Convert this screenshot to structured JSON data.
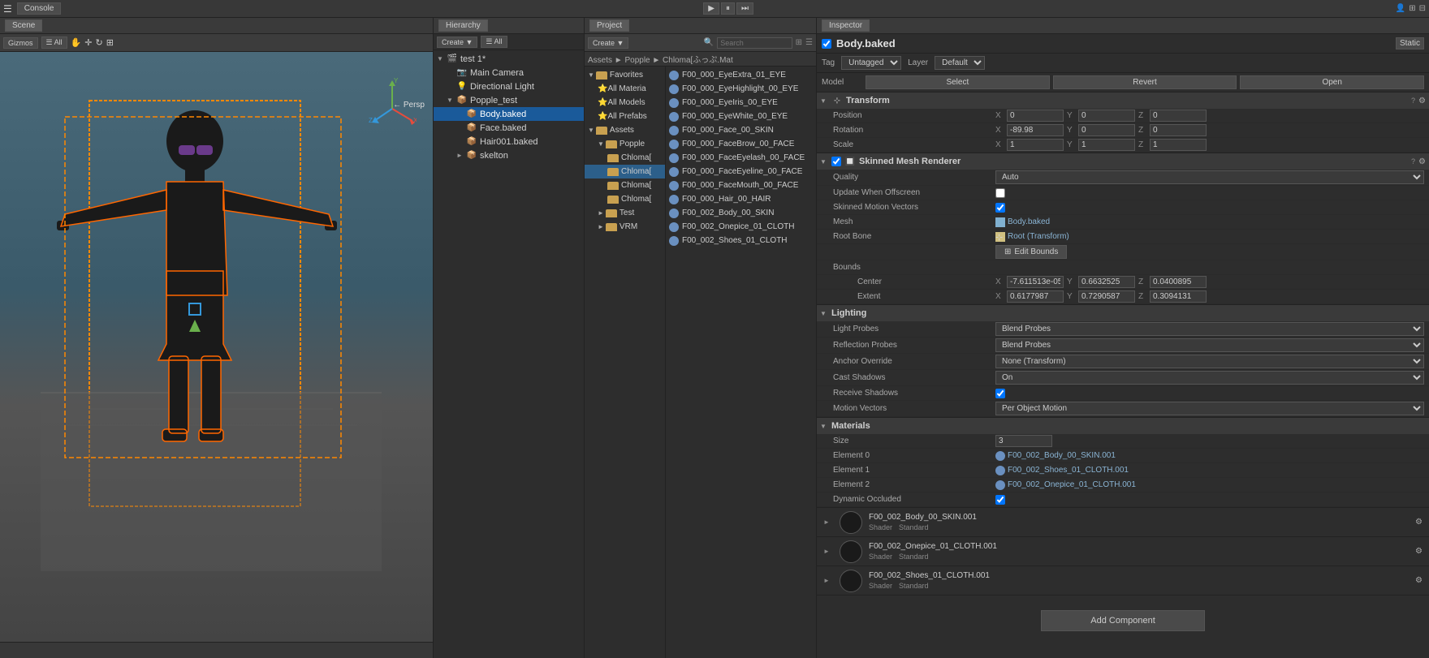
{
  "topbar": {
    "console_label": "Console",
    "play_btn": "▶",
    "pause_btn": "⏸",
    "step_btn": "⏭"
  },
  "scene": {
    "tab_label": "Scene",
    "toolbar": {
      "gizmos_btn": "Gizmos",
      "all_btn": "☰ All"
    },
    "persp_label": "← Persp"
  },
  "hierarchy": {
    "tab_label": "Hierarchy",
    "create_btn": "Create ▼",
    "all_btn": "☰ All",
    "scene_name": "test 1*",
    "items": [
      {
        "label": "Main Camera",
        "indent": 1,
        "type": "camera",
        "selected": false
      },
      {
        "label": "Directional Light",
        "indent": 1,
        "type": "light",
        "selected": false
      },
      {
        "label": "Popple_test",
        "indent": 1,
        "type": "folder",
        "expanded": true,
        "selected": false
      },
      {
        "label": "Body.baked",
        "indent": 2,
        "type": "object",
        "selected": true,
        "active": true
      },
      {
        "label": "Face.baked",
        "indent": 2,
        "type": "object",
        "selected": false
      },
      {
        "label": "Hair001.baked",
        "indent": 2,
        "type": "object",
        "selected": false
      },
      {
        "label": "skelton",
        "indent": 2,
        "type": "folder",
        "selected": false
      }
    ]
  },
  "project": {
    "tab_label": "Project",
    "create_btn": "Create ▼",
    "search_placeholder": "Search",
    "breadcrumb": "Assets ► Popple ► Chloma[ふっぷ.Mat",
    "left_items": [
      {
        "label": "Favorites",
        "type": "folder",
        "expanded": true
      },
      {
        "label": "All Materia",
        "indent": 1,
        "type": "search"
      },
      {
        "label": "All Models",
        "indent": 1,
        "type": "search"
      },
      {
        "label": "All Prefabs",
        "indent": 1,
        "type": "search"
      },
      {
        "label": "Assets",
        "type": "folder",
        "expanded": true
      },
      {
        "label": "Popple",
        "indent": 1,
        "type": "folder",
        "expanded": true
      },
      {
        "label": "Chloma[",
        "indent": 2,
        "type": "folder"
      },
      {
        "label": "Chloma[",
        "indent": 2,
        "type": "folder",
        "selected": true
      },
      {
        "label": "Chloma[",
        "indent": 2,
        "type": "folder"
      },
      {
        "label": "Chloma[",
        "indent": 2,
        "type": "folder"
      },
      {
        "label": "Test",
        "indent": 1,
        "type": "folder"
      },
      {
        "label": "VRM",
        "indent": 1,
        "type": "folder"
      }
    ],
    "right_items": [
      "F00_000_EyeExtra_01_EYE",
      "F00_000_EyeHighlight_00_EYE",
      "F00_000_EyeIris_00_EYE",
      "F00_000_EyeWhite_00_EYE",
      "F00_000_Face_00_SKIN",
      "F00_000_FaceBrow_00_FACE",
      "F00_000_FaceEyelash_00_FACE",
      "F00_000_FaceEyeline_00_FACE",
      "F00_000_FaceMouth_00_FACE",
      "F00_000_Hair_00_HAIR",
      "F00_002_Body_00_SKIN",
      "F00_002_Onepice_01_CLOTH",
      "F00_002_Shoes_01_CLOTH"
    ]
  },
  "inspector": {
    "tab_label": "Inspector",
    "object_name": "Body.baked",
    "checkbox_checked": true,
    "static_label": "Static",
    "tag_label": "Tag",
    "tag_value": "Untagged",
    "layer_label": "Layer",
    "layer_value": "Default",
    "model_label": "Model",
    "select_btn": "Select",
    "revert_btn": "Revert",
    "open_btn": "Open",
    "transform": {
      "title": "Transform",
      "position_label": "Position",
      "rotation_label": "Rotation",
      "scale_label": "Scale",
      "pos_x": "0",
      "pos_y": "0",
      "pos_z": "0",
      "rot_x": "-89.98",
      "rot_y": "0",
      "rot_z": "0",
      "scale_x": "1",
      "scale_y": "1",
      "scale_z": "1"
    },
    "skinned_mesh": {
      "title": "Skinned Mesh Renderer",
      "quality_label": "Quality",
      "quality_value": "Auto",
      "update_offscreen_label": "Update When Offscreen",
      "skinned_motion_label": "Skinned Motion Vectors",
      "skinned_motion_checked": true,
      "mesh_label": "Mesh",
      "mesh_value": "Body.baked",
      "root_bone_label": "Root Bone",
      "root_bone_value": "Root (Transform)",
      "bounds_label": "Bounds",
      "edit_bounds_btn": "Edit Bounds",
      "center_label": "Center",
      "center_x": "-7.611513e-05",
      "center_y": "0.6632525",
      "center_z": "0.0400895",
      "extent_label": "Extent",
      "extent_x": "0.6177987",
      "extent_y": "0.7290587",
      "extent_z": "0.3094131"
    },
    "lighting": {
      "title": "Lighting",
      "light_probes_label": "Light Probes",
      "light_probes_value": "Blend Probes",
      "reflection_probes_label": "Reflection Probes",
      "reflection_probes_value": "Blend Probes",
      "anchor_override_label": "Anchor Override",
      "anchor_override_value": "None (Transform)",
      "cast_shadows_label": "Cast Shadows",
      "cast_shadows_value": "On",
      "receive_shadows_label": "Receive Shadows",
      "receive_shadows_checked": true,
      "motion_vectors_label": "Motion Vectors",
      "motion_vectors_value": "Per Object Motion"
    },
    "materials": {
      "title": "Materials",
      "size_label": "Size",
      "size_value": "3",
      "element0_label": "Element 0",
      "element0_value": "F00_002_Body_00_SKIN.001",
      "element1_label": "Element 1",
      "element1_value": "F00_002_Shoes_01_CLOTH.001",
      "element2_label": "Element 2",
      "element2_value": "F00_002_Onepice_01_CLOTH.001",
      "dynamic_occluded_label": "Dynamic Occluded",
      "dynamic_occluded_checked": true
    },
    "mat_items": [
      {
        "name": "F00_002_Body_00_SKIN.001",
        "shader": "Standard"
      },
      {
        "name": "F00_002_Onepice_01_CLOTH.001",
        "shader": "Standard"
      },
      {
        "name": "F00_002_Shoes_01_CLOTH.001",
        "shader": "Standard"
      }
    ],
    "add_component_btn": "Add Component"
  }
}
